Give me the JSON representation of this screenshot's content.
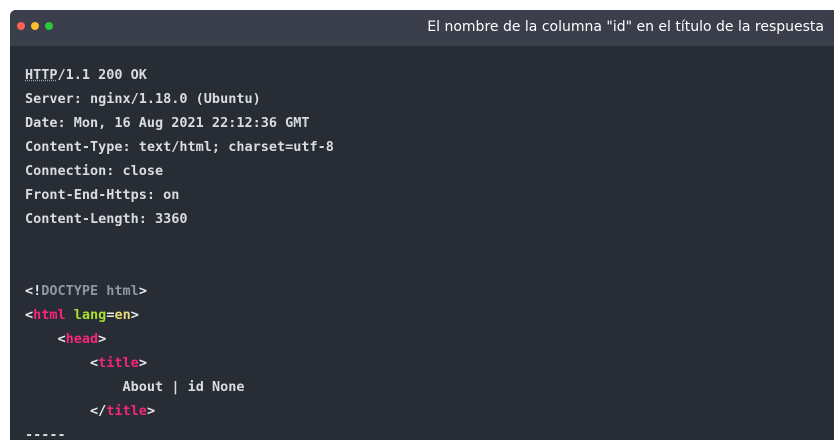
{
  "window": {
    "title": "El nombre de la columna \"id\" en el título de la respuesta",
    "dot_colors": [
      "#ff5f57",
      "#ffbd2e",
      "#28c840"
    ]
  },
  "response": {
    "status_protocol": "HTTP",
    "status_rest": "/1.1 200 OK",
    "headers": [
      "Server: nginx/1.18.0 (Ubuntu)",
      "Date: Mon, 16 Aug 2021 22:12:36 GMT",
      "Content-Type: text/html; charset=utf-8",
      "Connection: close",
      "Front-End-Https: on",
      "Content-Length: 3360"
    ]
  },
  "html_body": {
    "doctype_open": "<!",
    "doctype_keyword": "DOCTYPE",
    "doctype_name": " html",
    "doctype_close": ">",
    "html_tag": "html",
    "lang_attr": "lang",
    "lang_value": "en",
    "head_tag": "head",
    "title_tag": "title",
    "title_text": "About | id None",
    "separator": "-----"
  }
}
